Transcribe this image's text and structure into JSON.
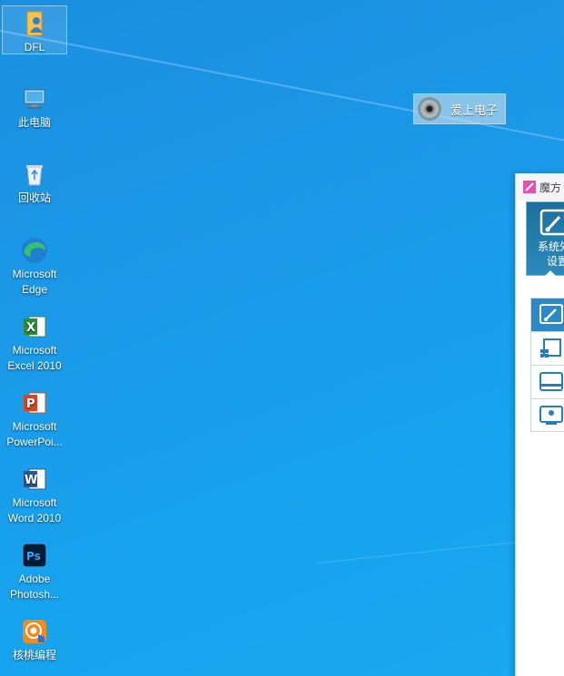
{
  "desktop": {
    "icons": [
      {
        "label": "DFL",
        "icon": "folder-user-icon"
      },
      {
        "label": "此电脑",
        "icon": "computer-icon"
      },
      {
        "label": "回收站",
        "icon": "recycle-bin-icon"
      },
      {
        "label": "Microsoft Edge",
        "icon": "edge-icon"
      },
      {
        "label": "Microsoft Excel 2010",
        "icon": "excel-icon"
      },
      {
        "label": "Microsoft PowerPoi...",
        "icon": "powerpoint-icon"
      },
      {
        "label": "Microsoft Word 2010",
        "icon": "word-icon"
      },
      {
        "label": "Adobe Photosh...",
        "icon": "photoshop-icon"
      },
      {
        "label": "核桃编程",
        "icon": "hetao-icon"
      }
    ]
  },
  "widget": {
    "label": "爱上电子",
    "icon": "disc-icon"
  },
  "app_window": {
    "title": "魔方",
    "big_tab_label_line1": "系统外",
    "big_tab_label_line2": "设置",
    "side_items": [
      {
        "icon": "settings-brush-icon",
        "active": true
      },
      {
        "icon": "windows-window-icon",
        "active": false
      },
      {
        "icon": "taskbar-icon",
        "active": false
      },
      {
        "icon": "desktop-user-icon",
        "active": false
      }
    ]
  },
  "colors": {
    "desktop_bg": "#1a9ae8",
    "accent": "#2c89c7"
  }
}
